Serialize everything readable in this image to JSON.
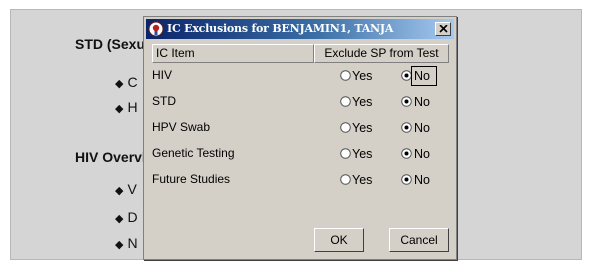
{
  "background": {
    "heading_1": "STD (Sexu",
    "heading_2": "HIV Overvi",
    "bullets": [
      "C",
      "H",
      "V",
      "D",
      "N"
    ],
    "bullet_glyph": "◆"
  },
  "dialog": {
    "title": "IC Exclusions for BENJAMIN1, TANJA",
    "close_glyph": "x",
    "columns": {
      "item": "IC Item",
      "exclude": "Exclude SP from Test"
    },
    "yes_label": "Yes",
    "no_label": "No",
    "rows": [
      {
        "item": "HIV",
        "selected": "No"
      },
      {
        "item": "STD",
        "selected": "No"
      },
      {
        "item": "HPV Swab",
        "selected": "No"
      },
      {
        "item": "Genetic Testing",
        "selected": "No"
      },
      {
        "item": "Future Studies",
        "selected": "No"
      }
    ],
    "ok_label": "OK",
    "cancel_label": "Cancel"
  },
  "colors": {
    "titlebar_start": "#0a246a",
    "titlebar_end": "#a6caf0",
    "dialog_face": "#d4d0c8"
  },
  "icons": {
    "title_icon": "application-icon",
    "close": "close-icon",
    "radio": "radio-button-icon"
  }
}
